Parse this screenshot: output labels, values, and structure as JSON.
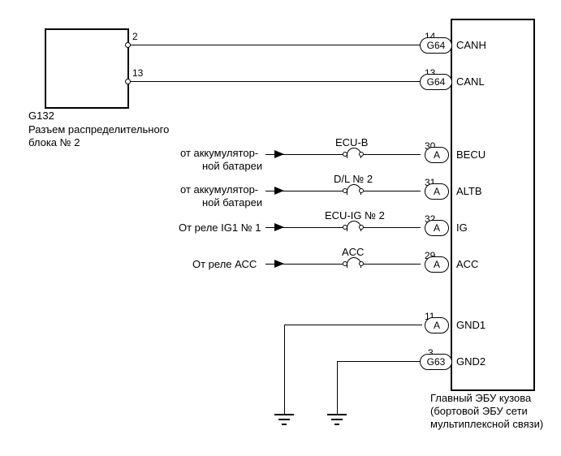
{
  "left_block": {
    "id": "G132",
    "desc_line1": "Разъем распределительного",
    "desc_line2": "блока № 2",
    "pins": {
      "top": "2",
      "bottom": "13"
    }
  },
  "ecu": {
    "title_line1": "Главный ЭБУ кузова",
    "title_line2": "(бортовой ЭБУ сети",
    "title_line3": "мультиплексной связи)",
    "connectors": {
      "canh": {
        "pin": "14",
        "conn": "G64",
        "name": "CANH"
      },
      "canl": {
        "pin": "13",
        "conn": "G64",
        "name": "CANL"
      },
      "becu": {
        "pin": "30",
        "conn": "A",
        "name": "BECU"
      },
      "altb": {
        "pin": "31",
        "conn": "A",
        "name": "ALTB"
      },
      "ig": {
        "pin": "32",
        "conn": "A",
        "name": "IG"
      },
      "acc": {
        "pin": "29",
        "conn": "A",
        "name": "ACC"
      },
      "gnd1": {
        "pin": "11",
        "conn": "A",
        "name": "GND1"
      },
      "gnd2": {
        "pin": "3",
        "conn": "G63",
        "name": "GND2"
      }
    }
  },
  "sources": {
    "battery1": {
      "line1": "от аккумулятор-",
      "line2": "ной батареи"
    },
    "battery2": {
      "line1": "от аккумулятор-",
      "line2": "ной батареи"
    },
    "ig_relay": "От реле IG1 № 1",
    "acc_relay": "От реле АСС"
  },
  "fuses": {
    "ecub": "ECU-B",
    "dl2": "D/L № 2",
    "ecuig": "ECU-IG № 2",
    "acc": "ACC"
  }
}
